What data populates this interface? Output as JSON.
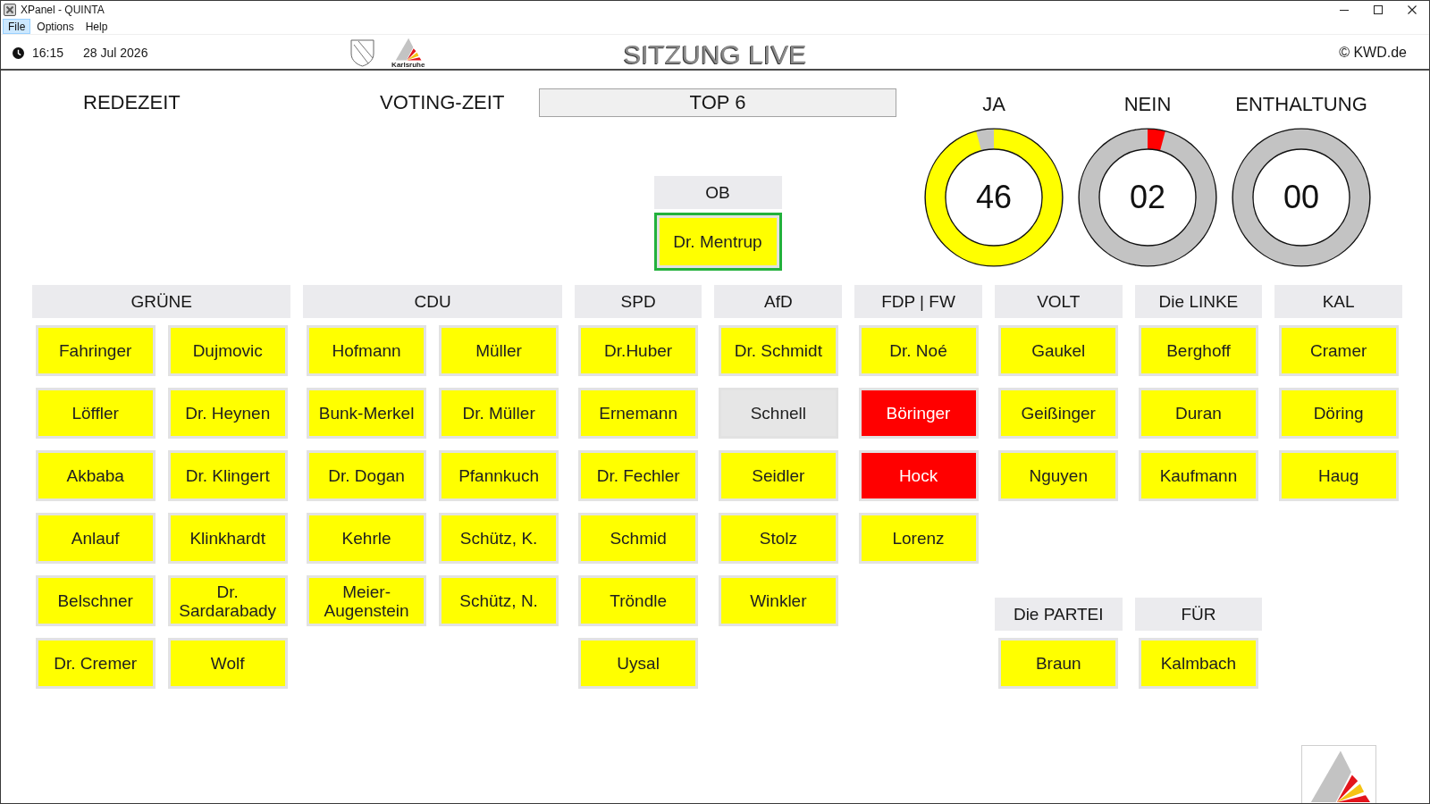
{
  "window": {
    "title": "XPanel - QUINTA"
  },
  "menu": [
    {
      "label": "File",
      "selected": true
    },
    {
      "label": "Options",
      "selected": false
    },
    {
      "label": "Help",
      "selected": false
    }
  ],
  "header": {
    "time": "16:15",
    "date": "28 Jul 2026",
    "logo_text": "Karlsruhe",
    "title": "SITZUNG LIVE",
    "copyright": "© KWD.de"
  },
  "session": {
    "speaking_time_label": "REDEZEIT",
    "voting_time_label": "VOTING-ZEIT",
    "agenda_item": "TOP 6"
  },
  "tallies": [
    {
      "kind": "yes",
      "label": "JA",
      "count": "46"
    },
    {
      "kind": "no",
      "label": "NEIN",
      "count": "02"
    },
    {
      "kind": "abstain",
      "label": "ENTHALTUNG",
      "count": "00"
    }
  ],
  "mayor": {
    "label": "OB",
    "member": {
      "name": "Dr. Mentrup",
      "color": "#ffff00"
    }
  },
  "party_columns": [
    {
      "groups": [
        {
          "name": "GRÜNE",
          "members": [
            {
              "name": "Fahringer",
              "color": "#ffff00"
            },
            {
              "name": "Dujmovic",
              "color": "#ffff00"
            },
            {
              "name": "Löffler",
              "color": "#ffff00"
            },
            {
              "name": "Dr. Heynen",
              "color": "#ffff00"
            },
            {
              "name": "Akbaba",
              "color": "#ffff00"
            },
            {
              "name": "Dr. Klingert",
              "color": "#ffff00"
            },
            {
              "name": "Anlauf",
              "color": "#ffff00"
            },
            {
              "name": "Klinkhardt",
              "color": "#ffff00"
            },
            {
              "name": "Belschner",
              "color": "#ffff00"
            },
            {
              "name": "Dr. Sardarabady",
              "color": "#ffff00"
            },
            {
              "name": "Dr. Cremer",
              "color": "#ffff00"
            },
            {
              "name": "Wolf",
              "color": "#ffff00"
            }
          ]
        }
      ]
    },
    {
      "groups": [
        {
          "name": "CDU",
          "members": [
            {
              "name": "Hofmann",
              "color": "#ffff00"
            },
            {
              "name": "Müller",
              "color": "#ffff00"
            },
            {
              "name": "Bunk-Merkel",
              "color": "#ffff00"
            },
            {
              "name": "Dr. Müller",
              "color": "#ffff00"
            },
            {
              "name": "Dr. Dogan",
              "color": "#ffff00"
            },
            {
              "name": "Pfannkuch",
              "color": "#ffff00"
            },
            {
              "name": "Kehrle",
              "color": "#ffff00"
            },
            {
              "name": "Schütz, K.",
              "color": "#ffff00"
            },
            {
              "name": "Meier-Augenstein",
              "color": "#ffff00"
            },
            {
              "name": "Schütz, N.",
              "color": "#ffff00"
            }
          ]
        }
      ]
    },
    {
      "groups": [
        {
          "name": "SPD",
          "members": [
            {
              "name": "Dr.Huber",
              "color": "#ffff00"
            },
            {
              "name": "Ernemann",
              "color": "#ffff00"
            },
            {
              "name": "Dr. Fechler",
              "color": "#ffff00"
            },
            {
              "name": "Schmid",
              "color": "#ffff00"
            },
            {
              "name": "Tröndle",
              "color": "#ffff00"
            },
            {
              "name": "Uysal",
              "color": "#ffff00"
            }
          ]
        }
      ]
    },
    {
      "groups": [
        {
          "name": "AfD",
          "members": [
            {
              "name": "Dr. Schmidt",
              "color": "#ffff00"
            },
            {
              "name": "Schnell",
              "color": "#e6e6e6"
            },
            {
              "name": "Seidler",
              "color": "#ffff00"
            },
            {
              "name": "Stolz",
              "color": "#ffff00"
            },
            {
              "name": "Winkler",
              "color": "#ffff00"
            }
          ]
        }
      ]
    },
    {
      "groups": [
        {
          "name": "FDP | FW",
          "members": [
            {
              "name": "Dr. Noé",
              "color": "#ffff00"
            },
            {
              "name": "Böringer",
              "color": "#ff0000"
            },
            {
              "name": "Hock",
              "color": "#ff0000"
            },
            {
              "name": "Lorenz",
              "color": "#ffff00"
            }
          ]
        }
      ]
    },
    {
      "groups": [
        {
          "name": "VOLT",
          "members": [
            {
              "name": "Gaukel",
              "color": "#ffff00"
            },
            {
              "name": "Geißinger",
              "color": "#ffff00"
            },
            {
              "name": "Nguyen",
              "color": "#ffff00"
            }
          ]
        },
        {
          "name": "Die PARTEI",
          "members": [
            {
              "name": "Braun",
              "color": "#ffff00"
            }
          ]
        }
      ]
    },
    {
      "groups": [
        {
          "name": "Die LINKE",
          "members": [
            {
              "name": "Berghoff",
              "color": "#ffff00"
            },
            {
              "name": "Duran",
              "color": "#ffff00"
            },
            {
              "name": "Kaufmann",
              "color": "#ffff00"
            }
          ]
        },
        {
          "name": "FÜR",
          "members": [
            {
              "name": "Kalmbach",
              "color": "#ffff00"
            }
          ]
        }
      ]
    },
    {
      "groups": [
        {
          "name": "KAL",
          "members": [
            {
              "name": "Cramer",
              "color": "#ffff00"
            },
            {
              "name": "Döring",
              "color": "#ffff00"
            },
            {
              "name": "Haug",
              "color": "#ffff00"
            }
          ]
        }
      ]
    }
  ]
}
